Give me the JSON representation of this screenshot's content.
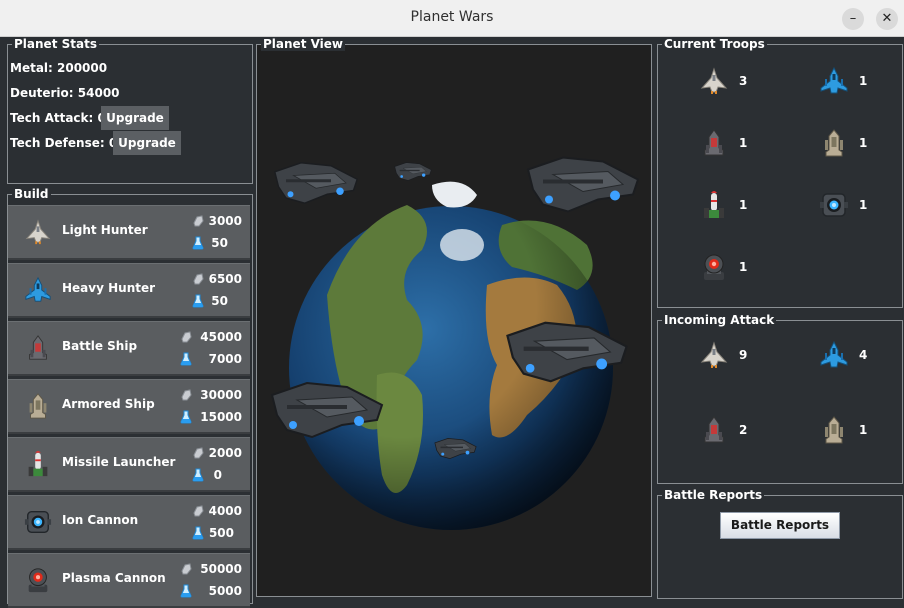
{
  "window": {
    "title": "Planet Wars",
    "minimize_glyph": "–",
    "close_glyph": "✕"
  },
  "planet_stats": {
    "legend": "Planet Stats",
    "metal": "Metal: 200000",
    "deuterio": "Deuterio: 54000",
    "tech_attack": "Tech Attack: 0",
    "tech_defense": "Tech Defense: 0",
    "upgrade_label": "Upgrade"
  },
  "build": {
    "legend": "Build",
    "items": [
      {
        "name": "Light Hunter",
        "metal": "3000",
        "deuterio": "50",
        "icon": "light-hunter-icon"
      },
      {
        "name": "Heavy Hunter",
        "metal": "6500",
        "deuterio": "50",
        "icon": "heavy-hunter-icon"
      },
      {
        "name": "Battle Ship",
        "metal": "45000",
        "deuterio": "7000",
        "icon": "battle-ship-icon"
      },
      {
        "name": "Armored Ship",
        "metal": "30000",
        "deuterio": "15000",
        "icon": "armored-ship-icon"
      },
      {
        "name": "Missile Launcher",
        "metal": "2000",
        "deuterio": "0",
        "icon": "missile-launcher-icon"
      },
      {
        "name": "Ion Cannon",
        "metal": "4000",
        "deuterio": "500",
        "icon": "ion-cannon-icon"
      },
      {
        "name": "Plasma Cannon",
        "metal": "50000",
        "deuterio": "5000",
        "icon": "plasma-cannon-icon"
      }
    ]
  },
  "planet_view": {
    "legend": "Planet View"
  },
  "current_troops": {
    "legend": "Current Troops",
    "items": [
      {
        "icon": "light-hunter-icon",
        "count": "3"
      },
      {
        "icon": "heavy-hunter-icon",
        "count": "1"
      },
      {
        "icon": "battle-ship-icon",
        "count": "1"
      },
      {
        "icon": "armored-ship-icon",
        "count": "1"
      },
      {
        "icon": "missile-launcher-icon",
        "count": "1"
      },
      {
        "icon": "ion-cannon-icon",
        "count": "1"
      },
      {
        "icon": "plasma-cannon-icon",
        "count": "1"
      }
    ]
  },
  "incoming_attack": {
    "legend": "Incoming Attack",
    "items": [
      {
        "icon": "light-hunter-icon",
        "count": "9"
      },
      {
        "icon": "heavy-hunter-icon",
        "count": "4"
      },
      {
        "icon": "battle-ship-icon",
        "count": "2"
      },
      {
        "icon": "armored-ship-icon",
        "count": "1"
      }
    ]
  },
  "battle_reports": {
    "legend": "Battle Reports",
    "button_label": "Battle Reports"
  }
}
